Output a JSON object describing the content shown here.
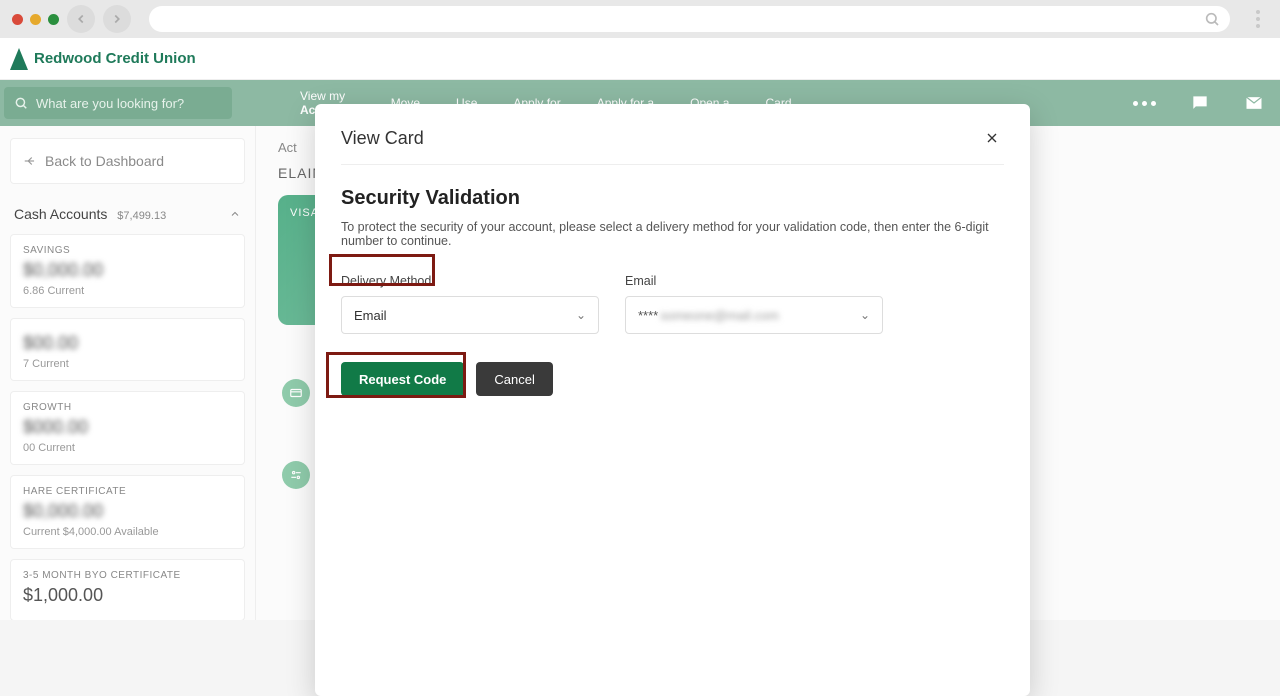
{
  "browser": {
    "omnibox_placeholder": ""
  },
  "brand": {
    "name": "Redwood Credit Union"
  },
  "nav": {
    "search_placeholder": "What are you looking for?",
    "items": [
      {
        "l1": "View my",
        "l2": "Accounts"
      },
      {
        "l1": "Move",
        "l2": ""
      },
      {
        "l1": "Use",
        "l2": ""
      },
      {
        "l1": "Apply for",
        "l2": ""
      },
      {
        "l1": "Apply for a",
        "l2": ""
      },
      {
        "l1": "Open a",
        "l2": ""
      },
      {
        "l1": "Card",
        "l2": ""
      }
    ]
  },
  "sidebar": {
    "back": "Back to Dashboard",
    "cash_label": "Cash Accounts",
    "cash_total": "$7,499.13",
    "accounts": [
      {
        "name": "SAVINGS",
        "bal": "$0,000.00",
        "sub": "6.86 Current"
      },
      {
        "name": " ",
        "bal": "$00.00",
        "sub": "7 Current"
      },
      {
        "name": "GROWTH",
        "bal": "$000.00",
        "sub": "00 Current"
      },
      {
        "name": "HARE CERTIFICATE",
        "bal": "$0,000.00",
        "sub": "Current   $4,000.00 Available"
      },
      {
        "name": "3-5 MONTH BYO CERTIFICATE",
        "bal": "$1,000.00",
        "sub": ""
      }
    ]
  },
  "main": {
    "tab": "Act",
    "owner": "ELAINE",
    "cardlabel": "VISA"
  },
  "modal": {
    "title": "View Card",
    "heading": "Security Validation",
    "desc": "To protect the security of your account, please select a delivery method for your validation code, then enter the 6-digit number to continue.",
    "delivery_label": "Delivery Method",
    "delivery_value": "Email",
    "email_label": "Email",
    "email_masked": "****",
    "request_btn": "Request Code",
    "cancel_btn": "Cancel"
  }
}
